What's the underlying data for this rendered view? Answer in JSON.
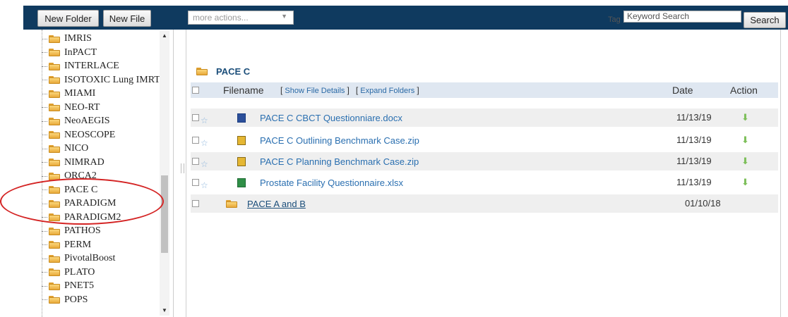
{
  "toolbar": {
    "new_folder": "New Folder",
    "new_file": "New File",
    "actions_placeholder": "more actions...",
    "tag_label": "Tag",
    "keyword_value": "Keyword Search",
    "search": "Search"
  },
  "sidebar": {
    "items": [
      {
        "label": "IMRIS"
      },
      {
        "label": "InPACT"
      },
      {
        "label": "INTERLACE"
      },
      {
        "label": "ISOTOXIC Lung IMRT"
      },
      {
        "label": "MIAMI"
      },
      {
        "label": "NEO-RT"
      },
      {
        "label": "NeoAEGIS"
      },
      {
        "label": "NEOSCOPE"
      },
      {
        "label": "NICO"
      },
      {
        "label": "NIMRAD"
      },
      {
        "label": "ORCA2"
      },
      {
        "label": "PACE C"
      },
      {
        "label": "PARADIGM"
      },
      {
        "label": "PARADIGM2"
      },
      {
        "label": "PATHOS"
      },
      {
        "label": "PERM"
      },
      {
        "label": "PivotalBoost"
      },
      {
        "label": "PLATO"
      },
      {
        "label": "PNET5"
      },
      {
        "label": "POPS"
      }
    ]
  },
  "main": {
    "current_folder": "PACE C",
    "headers": {
      "filename": "Filename",
      "show_details": "Show File Details",
      "expand_folders": "Expand Folders",
      "date": "Date",
      "action": "Action"
    },
    "files": [
      {
        "name": "PACE C CBCT Questionniare.docx",
        "date": "11/13/19",
        "icon": "word-doc-icon"
      },
      {
        "name": "PACE C Outlining Benchmark Case.zip",
        "date": "11/13/19",
        "icon": "zip-archive-icon"
      },
      {
        "name": "PACE C Planning Benchmark Case.zip",
        "date": "11/13/19",
        "icon": "zip-archive-icon"
      },
      {
        "name": "Prostate Facility Questionnaire.xlsx",
        "date": "11/13/19",
        "icon": "excel-sheet-icon"
      }
    ],
    "folders": [
      {
        "name": "PACE A and B",
        "date": "01/10/18"
      }
    ]
  },
  "colors": {
    "topbar": "#0f3a5f",
    "header_row": "#dfe7f1",
    "link": "#2a6fb0",
    "highlight_oval": "#d42424"
  }
}
